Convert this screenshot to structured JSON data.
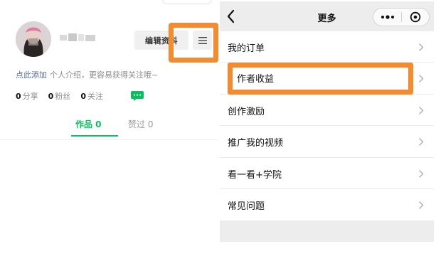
{
  "profile": {
    "edit_label": "编辑资料",
    "bio_link": "点此添加",
    "bio_placeholder": "个人介绍，更容易获得关注哦~",
    "stats": [
      {
        "count": "0",
        "label": "分享"
      },
      {
        "count": "0",
        "label": "粉丝"
      },
      {
        "count": "0",
        "label": "关注"
      }
    ],
    "tabs": [
      {
        "label": "作品 0",
        "active": true
      },
      {
        "label": "赞过 0",
        "active": false
      }
    ]
  },
  "more": {
    "title": "更多",
    "items": [
      {
        "label": "我的订单"
      },
      {
        "label": "作者收益",
        "highlighted": true
      },
      {
        "label": "创作激励"
      },
      {
        "label": "推广我的视频"
      },
      {
        "label": "看一看+学院"
      },
      {
        "label": "常见问题"
      }
    ]
  },
  "colors": {
    "accent_green": "#07c160",
    "highlight_orange": "#f58b2f",
    "link_blue": "#576b95",
    "muted_text": "#8a8a8a",
    "page_bg_gray": "#ededed"
  },
  "icons": {
    "menu": "hamburger-icon",
    "chat": "chat-bubble-icon",
    "back": "back-chevron-icon",
    "more": "more-dots-icon",
    "close": "close-circle-icon",
    "row": "chevron-right-icon"
  }
}
